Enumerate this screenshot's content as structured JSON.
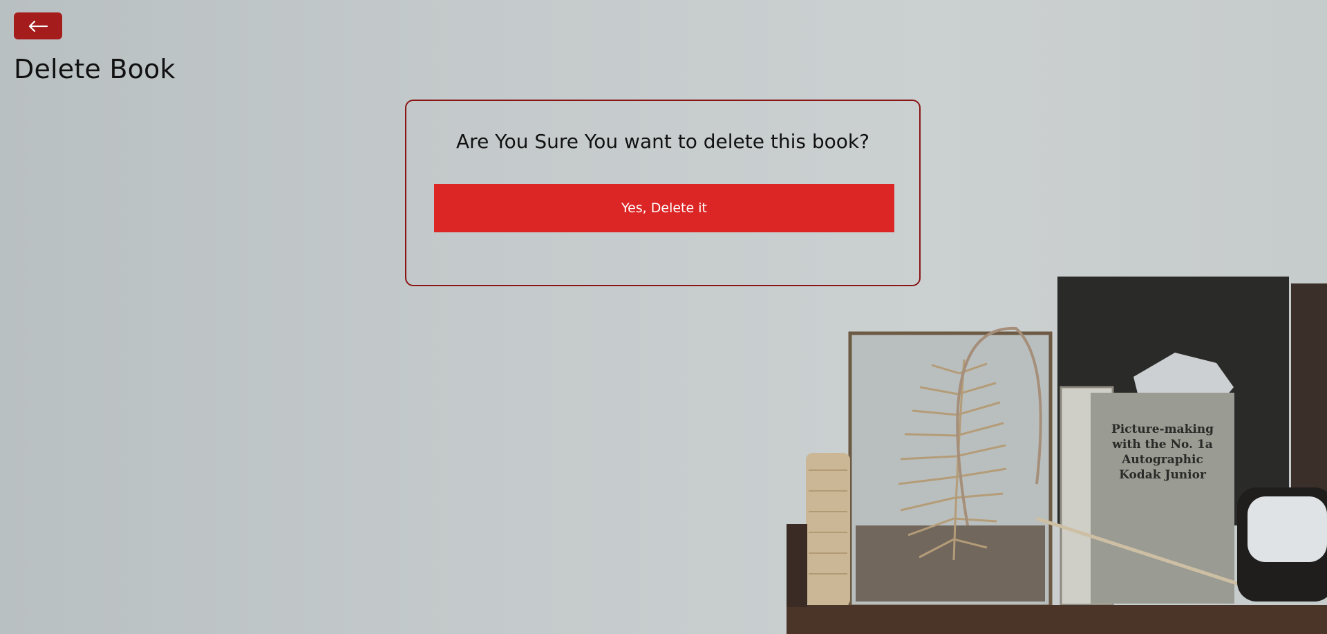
{
  "header": {
    "back_icon": "arrow-left-icon",
    "title": "Delete Book"
  },
  "dialog": {
    "question": "Are You Sure You want to delete this book?",
    "confirm_label": "Yes, Delete it"
  },
  "background": {
    "book_cover_text": "Picture-making\nwith the No. 1a\nAutographic\nKodak Junior"
  },
  "colors": {
    "accent_dark": "#a51c1c",
    "danger": "#dc2626",
    "card_border": "#8a1515"
  }
}
